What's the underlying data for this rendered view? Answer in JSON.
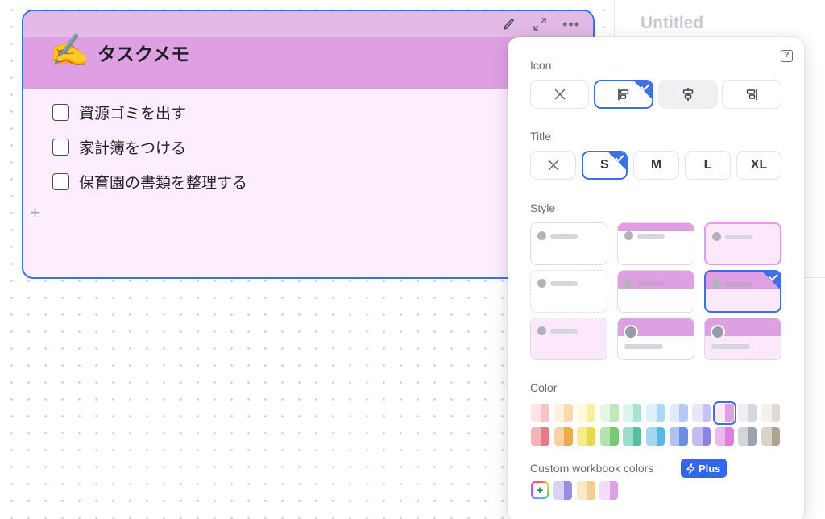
{
  "doc": {
    "title": "Untitled"
  },
  "card": {
    "emoji": "✍️",
    "title": "タスクメモ",
    "tasks": [
      {
        "label": "資源ゴミを出す",
        "checked": false
      },
      {
        "label": "家計簿をつける",
        "checked": false
      },
      {
        "label": "保育園の書類を整理する",
        "checked": false
      }
    ],
    "add_glyph": "+",
    "toolbar": {
      "more_glyph": "•••"
    }
  },
  "popover": {
    "help_glyph": "?",
    "icon": {
      "label": "Icon",
      "options": [
        "none",
        "align-left",
        "align-center",
        "align-right"
      ],
      "selected": "align-left"
    },
    "title": {
      "label": "Title",
      "sizes": [
        "S",
        "M",
        "L",
        "XL"
      ],
      "selected": "S"
    },
    "style": {
      "label": "Style",
      "selected_index": 5
    },
    "color": {
      "label": "Color",
      "selected_index": 8,
      "row1": [
        [
          "#fbe3e6",
          "#f6c3c9"
        ],
        [
          "#fdf0df",
          "#f9d9b0"
        ],
        [
          "#fdfbd9",
          "#f7ee9e"
        ],
        [
          "#e6f6e5",
          "#bfe9bb"
        ],
        [
          "#ddf4ee",
          "#a9e2d3"
        ],
        [
          "#def1fb",
          "#a9d9f3"
        ],
        [
          "#e1eafb",
          "#b5c9f2"
        ],
        [
          "#e8e6fb",
          "#c7c1f2"
        ],
        [
          "#fbe9fb",
          "#df9fe3"
        ],
        [
          "#eeeff3",
          "#d6d8e0"
        ],
        [
          "#f5f1ec",
          "#e1d8cf"
        ]
      ],
      "row2": [
        [
          "#f4b2b9",
          "#e87a86"
        ],
        [
          "#f8d2a0",
          "#f0a94e"
        ],
        [
          "#f6ec8a",
          "#e9d84a"
        ],
        [
          "#b5e3b0",
          "#79c974"
        ],
        [
          "#9fdcc9",
          "#56bfa0"
        ],
        [
          "#a6d6f1",
          "#5bb5e7"
        ],
        [
          "#afc4f0",
          "#6a8fe3"
        ],
        [
          "#c2bcf0",
          "#8d82e4"
        ],
        [
          "#ecb8ee",
          "#db7fe0"
        ],
        [
          "#d3d5dd",
          "#9da1ae"
        ],
        [
          "#dbd2c8",
          "#b0a394"
        ]
      ]
    },
    "custom": {
      "label": "Custom workbook colors",
      "plus_label": "Plus",
      "add_glyph": "+",
      "colors": [
        [
          "#d8d3f5",
          "#9a8be4"
        ],
        [
          "#fbe6c6",
          "#f4cf8f"
        ],
        [
          "#f3dcf5",
          "#dba1e0"
        ]
      ]
    }
  }
}
